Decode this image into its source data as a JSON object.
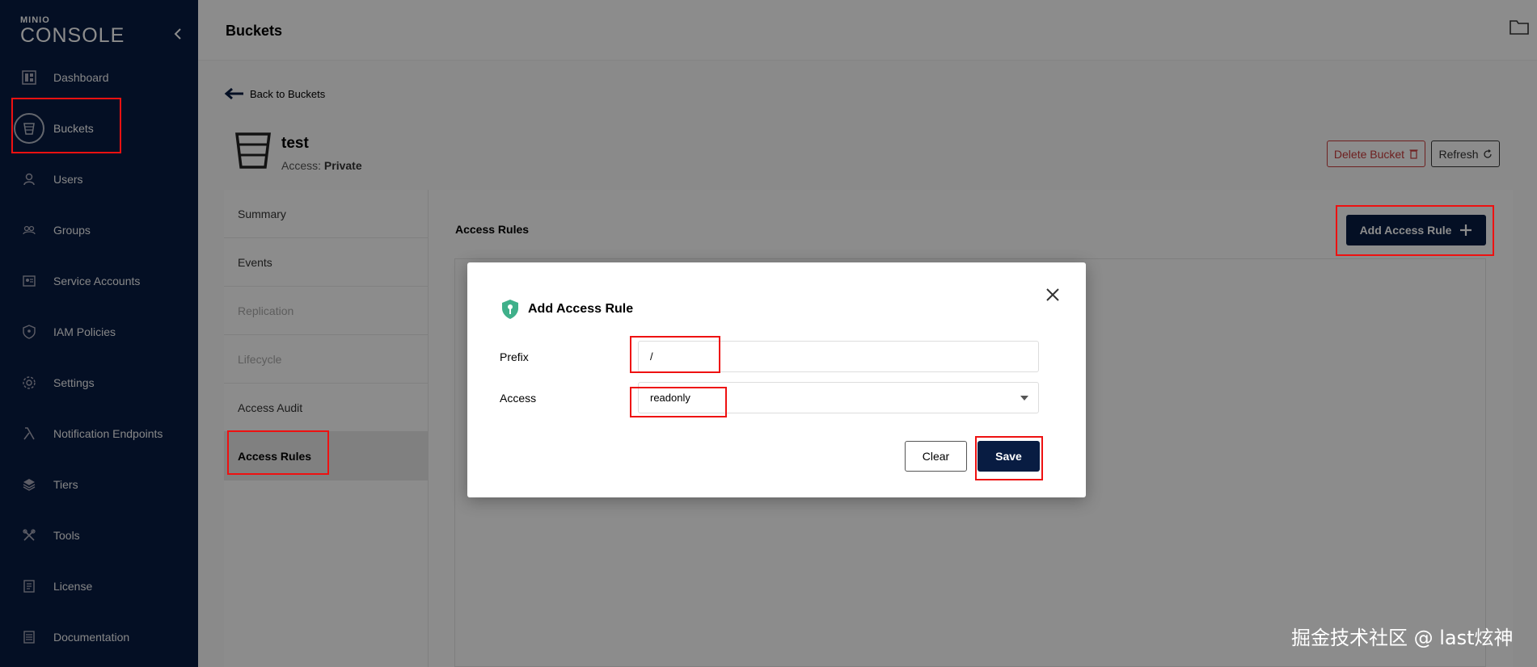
{
  "sidebar": {
    "logo_small": "MINIO",
    "logo_big": "CONSOLE",
    "items": [
      {
        "label": "Dashboard",
        "icon": "dashboard-icon"
      },
      {
        "label": "Buckets",
        "icon": "bucket-icon"
      },
      {
        "label": "Users",
        "icon": "user-icon"
      },
      {
        "label": "Groups",
        "icon": "groups-icon"
      },
      {
        "label": "Service Accounts",
        "icon": "service-accounts-icon"
      },
      {
        "label": "IAM Policies",
        "icon": "shield-icon"
      },
      {
        "label": "Settings",
        "icon": "gear-icon"
      },
      {
        "label": "Notification Endpoints",
        "icon": "lambda-icon"
      },
      {
        "label": "Tiers",
        "icon": "layers-icon"
      },
      {
        "label": "Tools",
        "icon": "tools-icon"
      },
      {
        "label": "License",
        "icon": "license-icon"
      },
      {
        "label": "Documentation",
        "icon": "documentation-icon"
      }
    ]
  },
  "header": {
    "title": "Buckets"
  },
  "back_link": "Back to Buckets",
  "bucket": {
    "name": "test",
    "access_label": "Access:",
    "access_value": "Private"
  },
  "actions": {
    "delete": "Delete Bucket",
    "refresh": "Refresh"
  },
  "tabs": [
    {
      "label": "Summary"
    },
    {
      "label": "Events"
    },
    {
      "label": "Replication"
    },
    {
      "label": "Lifecycle"
    },
    {
      "label": "Access Audit"
    },
    {
      "label": "Access Rules"
    }
  ],
  "content": {
    "section_title": "Access Rules",
    "add_button": "Add Access Rule"
  },
  "modal": {
    "title": "Add Access Rule",
    "prefix_label": "Prefix",
    "prefix_value": "/",
    "access_label": "Access",
    "access_value": "readonly",
    "clear_button": "Clear",
    "save_button": "Save"
  },
  "watermark": "掘金技术社区 @ last炫神",
  "colors": {
    "sidebar_bg": "#081c42",
    "primary": "#081c42",
    "danger": "#c83b3b",
    "highlight": "#ee1111"
  }
}
